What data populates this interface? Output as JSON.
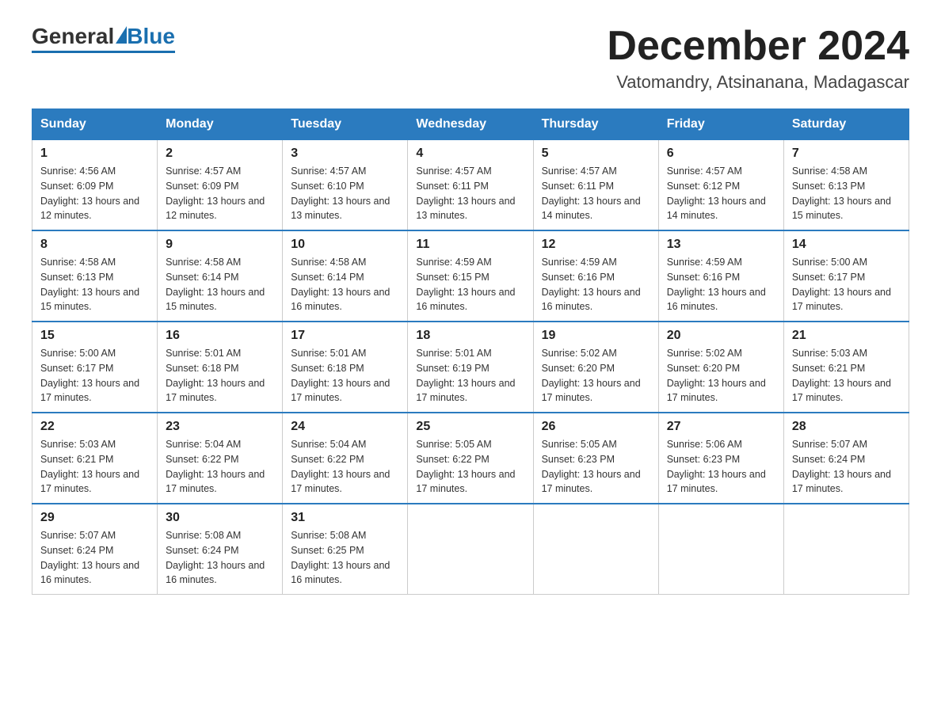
{
  "logo": {
    "general": "General",
    "blue": "Blue"
  },
  "header": {
    "month_title": "December 2024",
    "location": "Vatomandry, Atsinanana, Madagascar"
  },
  "days_of_week": [
    "Sunday",
    "Monday",
    "Tuesday",
    "Wednesday",
    "Thursday",
    "Friday",
    "Saturday"
  ],
  "weeks": [
    [
      {
        "day": "1",
        "sunrise": "4:56 AM",
        "sunset": "6:09 PM",
        "daylight": "13 hours and 12 minutes."
      },
      {
        "day": "2",
        "sunrise": "4:57 AM",
        "sunset": "6:09 PM",
        "daylight": "13 hours and 12 minutes."
      },
      {
        "day": "3",
        "sunrise": "4:57 AM",
        "sunset": "6:10 PM",
        "daylight": "13 hours and 13 minutes."
      },
      {
        "day": "4",
        "sunrise": "4:57 AM",
        "sunset": "6:11 PM",
        "daylight": "13 hours and 13 minutes."
      },
      {
        "day": "5",
        "sunrise": "4:57 AM",
        "sunset": "6:11 PM",
        "daylight": "13 hours and 14 minutes."
      },
      {
        "day": "6",
        "sunrise": "4:57 AM",
        "sunset": "6:12 PM",
        "daylight": "13 hours and 14 minutes."
      },
      {
        "day": "7",
        "sunrise": "4:58 AM",
        "sunset": "6:13 PM",
        "daylight": "13 hours and 15 minutes."
      }
    ],
    [
      {
        "day": "8",
        "sunrise": "4:58 AM",
        "sunset": "6:13 PM",
        "daylight": "13 hours and 15 minutes."
      },
      {
        "day": "9",
        "sunrise": "4:58 AM",
        "sunset": "6:14 PM",
        "daylight": "13 hours and 15 minutes."
      },
      {
        "day": "10",
        "sunrise": "4:58 AM",
        "sunset": "6:14 PM",
        "daylight": "13 hours and 16 minutes."
      },
      {
        "day": "11",
        "sunrise": "4:59 AM",
        "sunset": "6:15 PM",
        "daylight": "13 hours and 16 minutes."
      },
      {
        "day": "12",
        "sunrise": "4:59 AM",
        "sunset": "6:16 PM",
        "daylight": "13 hours and 16 minutes."
      },
      {
        "day": "13",
        "sunrise": "4:59 AM",
        "sunset": "6:16 PM",
        "daylight": "13 hours and 16 minutes."
      },
      {
        "day": "14",
        "sunrise": "5:00 AM",
        "sunset": "6:17 PM",
        "daylight": "13 hours and 17 minutes."
      }
    ],
    [
      {
        "day": "15",
        "sunrise": "5:00 AM",
        "sunset": "6:17 PM",
        "daylight": "13 hours and 17 minutes."
      },
      {
        "day": "16",
        "sunrise": "5:01 AM",
        "sunset": "6:18 PM",
        "daylight": "13 hours and 17 minutes."
      },
      {
        "day": "17",
        "sunrise": "5:01 AM",
        "sunset": "6:18 PM",
        "daylight": "13 hours and 17 minutes."
      },
      {
        "day": "18",
        "sunrise": "5:01 AM",
        "sunset": "6:19 PM",
        "daylight": "13 hours and 17 minutes."
      },
      {
        "day": "19",
        "sunrise": "5:02 AM",
        "sunset": "6:20 PM",
        "daylight": "13 hours and 17 minutes."
      },
      {
        "day": "20",
        "sunrise": "5:02 AM",
        "sunset": "6:20 PM",
        "daylight": "13 hours and 17 minutes."
      },
      {
        "day": "21",
        "sunrise": "5:03 AM",
        "sunset": "6:21 PM",
        "daylight": "13 hours and 17 minutes."
      }
    ],
    [
      {
        "day": "22",
        "sunrise": "5:03 AM",
        "sunset": "6:21 PM",
        "daylight": "13 hours and 17 minutes."
      },
      {
        "day": "23",
        "sunrise": "5:04 AM",
        "sunset": "6:22 PM",
        "daylight": "13 hours and 17 minutes."
      },
      {
        "day": "24",
        "sunrise": "5:04 AM",
        "sunset": "6:22 PM",
        "daylight": "13 hours and 17 minutes."
      },
      {
        "day": "25",
        "sunrise": "5:05 AM",
        "sunset": "6:22 PM",
        "daylight": "13 hours and 17 minutes."
      },
      {
        "day": "26",
        "sunrise": "5:05 AM",
        "sunset": "6:23 PM",
        "daylight": "13 hours and 17 minutes."
      },
      {
        "day": "27",
        "sunrise": "5:06 AM",
        "sunset": "6:23 PM",
        "daylight": "13 hours and 17 minutes."
      },
      {
        "day": "28",
        "sunrise": "5:07 AM",
        "sunset": "6:24 PM",
        "daylight": "13 hours and 17 minutes."
      }
    ],
    [
      {
        "day": "29",
        "sunrise": "5:07 AM",
        "sunset": "6:24 PM",
        "daylight": "13 hours and 16 minutes."
      },
      {
        "day": "30",
        "sunrise": "5:08 AM",
        "sunset": "6:24 PM",
        "daylight": "13 hours and 16 minutes."
      },
      {
        "day": "31",
        "sunrise": "5:08 AM",
        "sunset": "6:25 PM",
        "daylight": "13 hours and 16 minutes."
      },
      null,
      null,
      null,
      null
    ]
  ]
}
